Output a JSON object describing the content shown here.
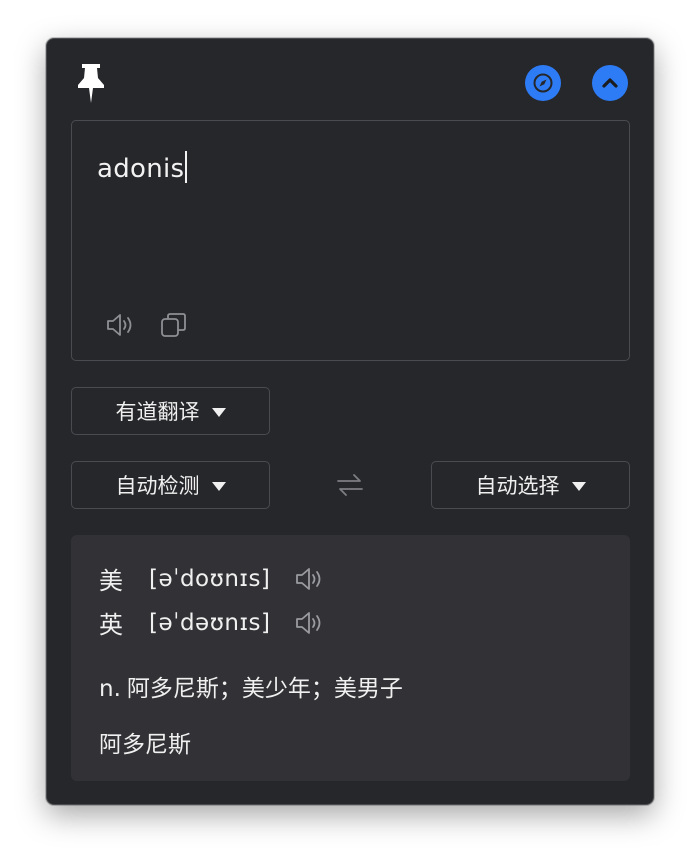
{
  "input": {
    "text": "adonis"
  },
  "toolbar": {
    "pin_icon": "pin-icon",
    "compass_icon": "compass-icon",
    "collapse_icon": "chevron-up-icon"
  },
  "engine": {
    "selected": "有道翻译"
  },
  "languages": {
    "source": "自动检测",
    "target": "自动选择"
  },
  "result": {
    "us_label": "美",
    "us_phonetic": "[əˈdoʊnɪs]",
    "uk_label": "英",
    "uk_phonetic": "[əˈdəʊnɪs]",
    "part_of_speech": "n.",
    "definition": "阿多尼斯；美少年；美男子",
    "extra": "阿多尼斯"
  },
  "colors": {
    "accent": "#2d7cf6",
    "background": "#26272b",
    "result_bg": "#323236"
  }
}
